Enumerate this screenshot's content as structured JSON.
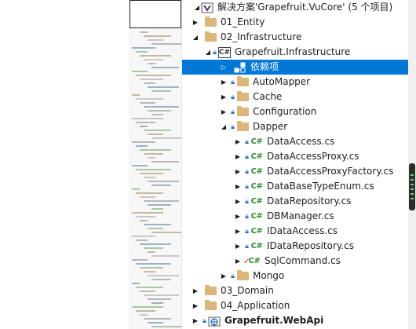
{
  "solution": {
    "title": "解决方案'Grapefruit.VuCore' (5 个项目)",
    "items": [
      {
        "label": "01_Entity"
      },
      {
        "label": "02_Infrastructure"
      },
      {
        "label": "Grapefruit.Infrastructure",
        "icon": "csharp-project-icon"
      },
      {
        "label": "依赖项",
        "icon": "dependencies-icon"
      },
      {
        "label": "AutoMapper"
      },
      {
        "label": "Cache"
      },
      {
        "label": "Configuration"
      },
      {
        "label": "Dapper"
      },
      {
        "label": "DataAccess.cs"
      },
      {
        "label": "DataAccessProxy.cs"
      },
      {
        "label": "DataAccessProxyFactory.cs"
      },
      {
        "label": "DataBaseTypeEnum.cs"
      },
      {
        "label": "DataRepository.cs"
      },
      {
        "label": "DBManager.cs"
      },
      {
        "label": "IDataAccess.cs"
      },
      {
        "label": "IDataRepository.cs"
      },
      {
        "label": "SqlCommand.cs"
      },
      {
        "label": "Mongo"
      },
      {
        "label": "03_Domain"
      },
      {
        "label": "04_Application"
      },
      {
        "label": "Grapefruit.WebApi",
        "icon": "web-project-icon"
      }
    ],
    "cs_glyph": "C#",
    "selected_index": 3
  },
  "colors": {
    "selection": "#0078d7",
    "folder": "#dcb67a",
    "csharp": "#2f8a2f"
  }
}
